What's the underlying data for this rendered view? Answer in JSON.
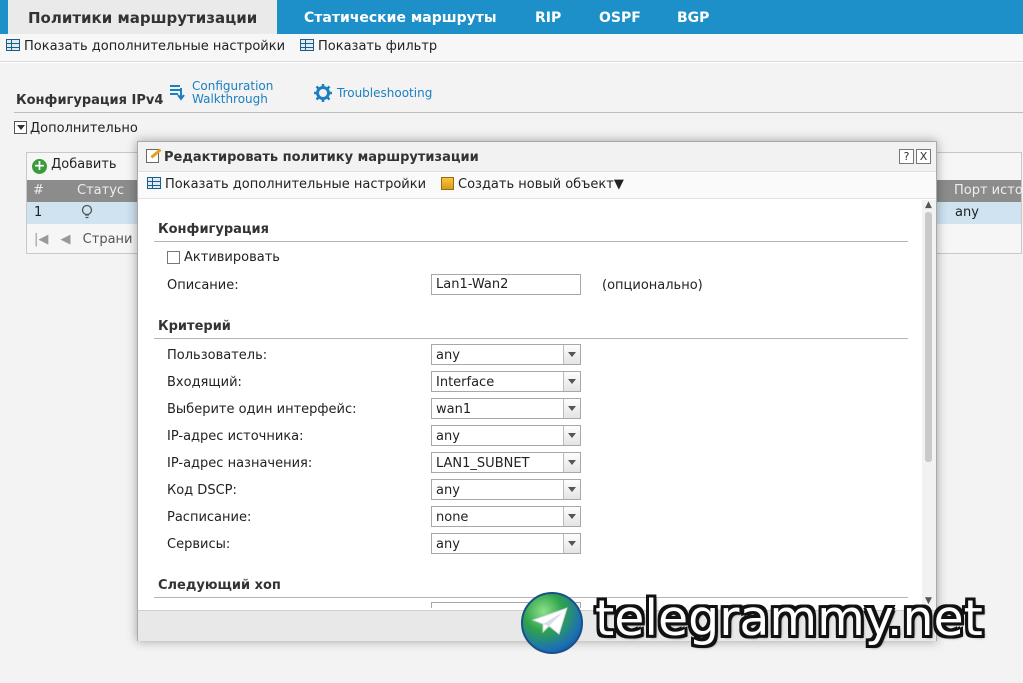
{
  "tabs": [
    {
      "label": "Политики маршрутизации",
      "active": true
    },
    {
      "label": "Статические маршруты",
      "active": false
    },
    {
      "label": "RIP",
      "active": false
    },
    {
      "label": "OSPF",
      "active": false
    },
    {
      "label": "BGP",
      "active": false
    }
  ],
  "toolbar": {
    "show_advanced": "Показать дополнительные настройки",
    "show_filter": "Показать фильтр"
  },
  "page": {
    "section_title": "Конфигурация IPv4",
    "config_walkthrough": [
      "Configuration",
      "Walkthrough"
    ],
    "troubleshooting": "Troubleshooting",
    "advanced_toggle": "Дополнительно",
    "add_button": "Добавить",
    "table_headers": {
      "num": "#",
      "status": "Статус",
      "src_port": "Порт исто"
    },
    "row": {
      "num": "1",
      "src_port": "any"
    },
    "pager_text": "Страни"
  },
  "dialog": {
    "title": "Редактировать политику маршрутизации",
    "help_btn": "?",
    "close_btn": "X",
    "show_advanced": "Показать дополнительные настройки",
    "create_object": "Создать новый объект",
    "sec_config": "Конфигурация",
    "activate_label": "Активировать",
    "activate_checked": false,
    "description_label": "Описание:",
    "description_value": "Lan1-Wan2",
    "optional_note": "(опционально)",
    "sec_criteria": "Критерий",
    "fields": [
      {
        "label": "Пользователь:",
        "value": "any"
      },
      {
        "label": "Входящий:",
        "value": "Interface"
      },
      {
        "label": "Выберите один интерфейс:",
        "value": "wan1"
      },
      {
        "label": "IP-адрес источника:",
        "value": "any"
      },
      {
        "label": "IP-адрес назначения:",
        "value": "LAN1_SUBNET"
      },
      {
        "label": "Код DSCP:",
        "value": "any"
      },
      {
        "label": "Расписание:",
        "value": "none"
      },
      {
        "label": "Сервисы:",
        "value": "any"
      }
    ],
    "sec_next_hop": "Следующий хоп"
  },
  "watermark": {
    "text": "telegrammy.net"
  },
  "colors": {
    "tabbar": "#1d8fc9",
    "link": "#1d7fc0",
    "row_selected": "#cfe3f1",
    "table_header": "#8c8c8c"
  }
}
